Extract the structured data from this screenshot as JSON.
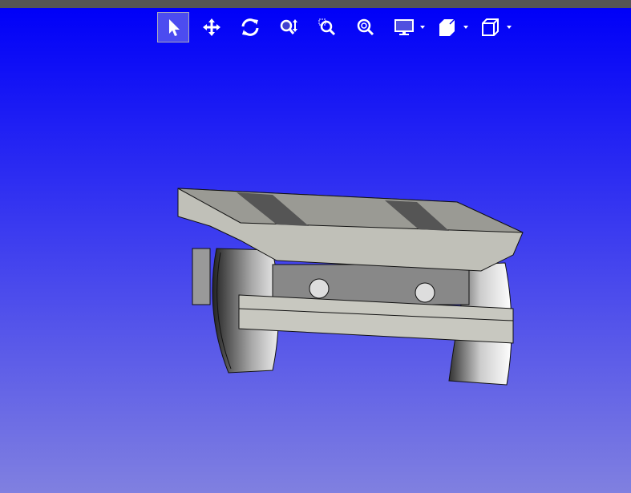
{
  "window": {
    "topbar_color": "#555555"
  },
  "viewport": {
    "background_top": "#0000f8",
    "background_bottom": "#8080e0"
  },
  "toolbar": {
    "tools": [
      {
        "name": "select",
        "icon": "pointer-icon",
        "active": true
      },
      {
        "name": "pan",
        "icon": "move-icon"
      },
      {
        "name": "rotate",
        "icon": "rotate-icon"
      },
      {
        "name": "zoom",
        "icon": "zoom-vertical-icon"
      },
      {
        "name": "zoom-window",
        "icon": "zoom-window-icon"
      },
      {
        "name": "zoom-fit",
        "icon": "zoom-fit-icon"
      },
      {
        "name": "display-mode",
        "icon": "monitor-icon",
        "dropdown": true
      },
      {
        "name": "section",
        "icon": "section-icon",
        "dropdown": true
      },
      {
        "name": "view-orientation",
        "icon": "cube-icon",
        "dropdown": true
      }
    ]
  },
  "model": {
    "description_color": "#c0c0b8"
  }
}
